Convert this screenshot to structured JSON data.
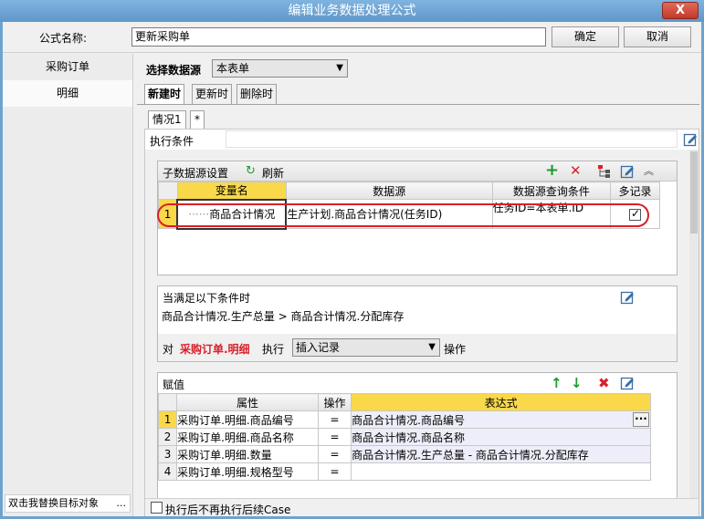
{
  "window": {
    "title": "编辑业务数据处理公式",
    "close_label": "X"
  },
  "formula": {
    "name_label": "公式名称:",
    "name_value": "更新采购单",
    "ok_label": "确定",
    "cancel_label": "取消"
  },
  "left": {
    "items": [
      {
        "label": "采购订单"
      },
      {
        "label": "明细"
      }
    ],
    "footer": "双击我替换目标对象",
    "footer_button": "..."
  },
  "datasource": {
    "label": "选择数据源",
    "value": "本表单"
  },
  "tabs": [
    {
      "label": "新建时"
    },
    {
      "label": "更新时"
    },
    {
      "label": "删除时"
    }
  ],
  "case_tabs": [
    {
      "label": "情况1"
    },
    {
      "label": "*"
    }
  ],
  "exec_condition_label": "执行条件",
  "sub_source": {
    "title": "子数据源设置",
    "refresh_label": "刷新",
    "columns": [
      "变量名",
      "数据源",
      "数据源查询条件",
      "多记录"
    ],
    "rows": [
      {
        "index": "1",
        "var": "商品合计情况",
        "source": "生产计划.商品合计情况(任务ID)",
        "condition": "任务ID=本表单.ID",
        "multi": true
      }
    ]
  },
  "condition": {
    "title": "当满足以下条件时",
    "expression": "商品合计情况.生产总量 > 商品合计情况.分配库存",
    "for_label": "对",
    "target": "采购订单.明细",
    "exec_label": "执行",
    "action": "插入记录",
    "op_label": "操作"
  },
  "assign": {
    "title": "赋值",
    "columns": [
      "属性",
      "操作",
      "表达式"
    ],
    "rows": [
      {
        "index": "1",
        "attr": "采购订单.明细.商品编号",
        "op": "=",
        "expr": "商品合计情况.商品编号"
      },
      {
        "index": "2",
        "attr": "采购订单.明细.商品名称",
        "op": "=",
        "expr": "商品合计情况.商品名称"
      },
      {
        "index": "3",
        "attr": "采购订单.明细.数量",
        "op": "=",
        "expr": "商品合计情况.生产总量 - 商品合计情况.分配库存"
      },
      {
        "index": "4",
        "attr": "采购订单.明细.规格型号",
        "op": "=",
        "expr": ""
      }
    ]
  },
  "footer_check": {
    "label": "执行后不再执行后续Case",
    "checked": false
  },
  "colors": {
    "accent": "#f9d84a",
    "highlight_ring": "#d8202a",
    "add_green": "#1e9a2a",
    "delete_red": "#d8202a"
  }
}
